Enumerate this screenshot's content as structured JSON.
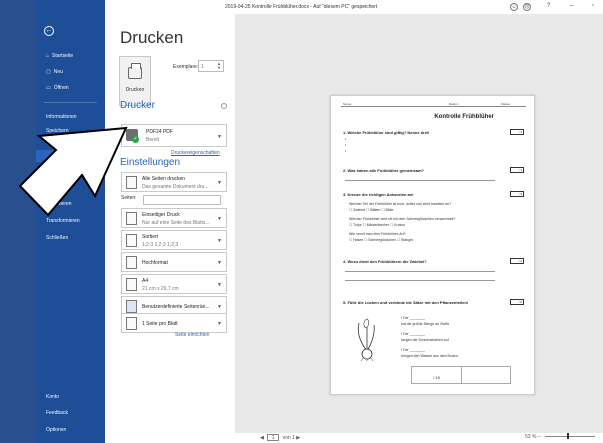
{
  "window": {
    "title": "2019-04-25 Kontrolle Frühblüher.docx - Auf \"diesem PC\" gespeichert"
  },
  "sidebar": {
    "items": [
      {
        "label": "Startseite",
        "icon": "home-icon"
      },
      {
        "label": "Neu",
        "icon": "new-document-icon"
      },
      {
        "label": "Öffnen",
        "icon": "folder-open-icon"
      },
      {
        "label": "Informationen"
      },
      {
        "label": "Speichern"
      },
      {
        "label": "Exportieren"
      },
      {
        "label": "Transformieren"
      },
      {
        "label": "Schließen"
      }
    ],
    "bottom_items": [
      {
        "label": "Konto"
      },
      {
        "label": "Feedback"
      },
      {
        "label": "Optionen"
      }
    ],
    "accent": "#1f4e99"
  },
  "print": {
    "heading": "Drucken",
    "print_button": "Drucken",
    "copies_label": "Exemplare:",
    "copies_value": "1",
    "printer_heading": "Drucker",
    "printer_name": "PDF24 PDF",
    "printer_status": "Bereit",
    "printer_properties": "Druckereigenschaften",
    "settings_heading": "Einstellungen",
    "settings": [
      {
        "t1": "Alle Seiten drucken",
        "t2": "Das gesamte Dokument dru..."
      },
      {
        "t1": "Einseitiger Druck",
        "t2": "Nur auf eine Seite des Blatts..."
      },
      {
        "t1": "Sortiert",
        "t2": "1;2;3    1;2;3    1;2;3"
      },
      {
        "t1": "Hochformat",
        "t2": ""
      },
      {
        "t1": "A4",
        "t2": "21 cm x 29,7 cm"
      },
      {
        "t1": "Benutzerdefinierte Seitenrän...",
        "t2": ""
      },
      {
        "t1": "1 Seite pro Blatt",
        "t2": ""
      }
    ],
    "pages_label": "Seiten:",
    "page_setup": "Seite einrichten"
  },
  "document": {
    "header": {
      "name": "Name:",
      "date": "Datum:",
      "class": "Klasse:"
    },
    "title": "Kontrolle Frühblüher",
    "questions": [
      {
        "text": "1. Welche Frühblüher sind giftig? Nenne drei!",
        "points": "/ 3"
      },
      {
        "text": "2. Was haben alle Frühblüher gemeinsam?",
        "points": "/ 1"
      },
      {
        "text": "3. Kreuze die richtigen Antworten an!",
        "points": "/ 3"
      },
      {
        "text": "4. Wozu dient den Frühblühern die Zwiebel?",
        "points": "/ 2"
      },
      {
        "text": "5. Fülle die Lücken und verbinde die Sätze mit den Pflanzenteilen!",
        "points": "/ 6"
      }
    ],
    "q3_lines": [
      "Welcher Teil der Frühblüher ist bunt, duftet und zieht Insekten an?",
      "☐ Zwiebel      ☐ Blätter      ☐ Blüte",
      "Welcher Frühblüher wird oft mit dem Schneeglöckchen verwechselt?",
      "☐ Tulpe      ☐ Märzenbecher      ☐ Krokus",
      "Wie nennt man eine Frühblüher-Art?",
      "☐ Hasen      ☐ Schneeglöckchen      ☐ Stängel"
    ],
    "q5_lines": [
      "• Die ________",
      "   hat die größte Menge an Stoffe",
      "• Die ________",
      "   fangen die Sonnenstrahlen auf",
      "• Die ________",
      "   bringen den Wasser aus dem Boden"
    ],
    "score": "/ 15"
  },
  "status": {
    "page_current": "1",
    "page_total": "von 1",
    "zoom": "53 %"
  }
}
